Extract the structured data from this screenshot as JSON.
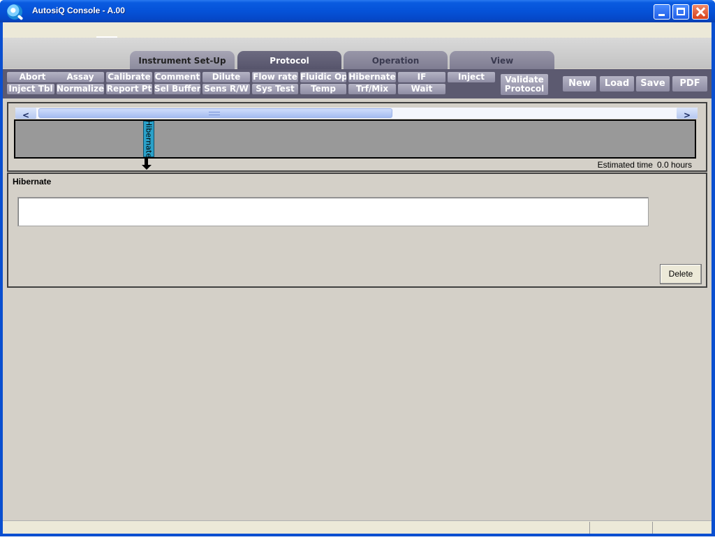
{
  "window": {
    "title": "AutosiQ Console - A.00"
  },
  "tabs": [
    {
      "label": "Instrument Set-Up"
    },
    {
      "label": "Protocol"
    },
    {
      "label": "Operation"
    },
    {
      "label": "View"
    }
  ],
  "active_tab": "Protocol",
  "toolbar": {
    "row1": [
      "Abort",
      "Assay",
      "Calibrate",
      "Comment",
      "Dilute",
      "Flow rate",
      "Fluidic Op",
      "Hibernate",
      "IF",
      "Inject"
    ],
    "row2": [
      "Inject Tbl",
      "Normalize",
      "Report Pt",
      "Sel Buffer",
      "Sens R/W",
      "Sys Test",
      "Temp",
      "Trf/Mix",
      "Wait"
    ],
    "validate": "Validate Protocol",
    "new": "New",
    "load": "Load",
    "save": "Save",
    "pdf": "PDF"
  },
  "timeline": {
    "scroll_left": "<",
    "scroll_right": ">",
    "steps": [
      {
        "label": "Hibernate"
      }
    ],
    "estimate_label": "Estimated time",
    "estimate_value": "0.0 hours"
  },
  "detail": {
    "title": "Hibernate",
    "field_value": "",
    "delete": "Delete"
  },
  "colors": {
    "titlebar": "#0552d8",
    "toolbar_bg": "#5c5a70",
    "step_color": "#2aa0c8",
    "panel_bg": "#d4d0c8"
  }
}
